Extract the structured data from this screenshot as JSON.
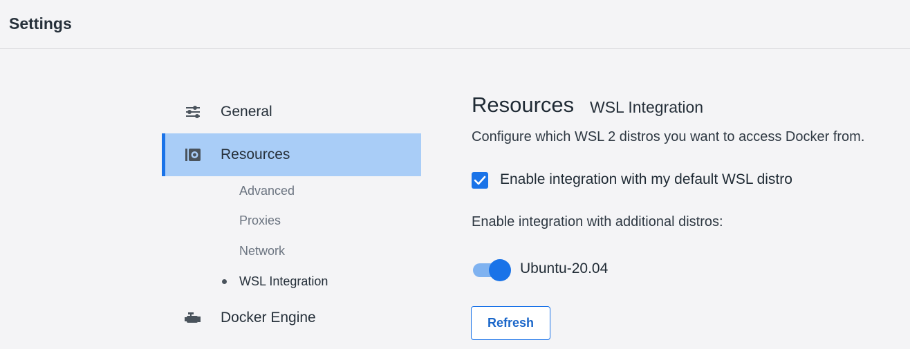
{
  "header": {
    "title": "Settings"
  },
  "sidebar": {
    "items": [
      {
        "label": "General",
        "icon": "sliders-icon"
      },
      {
        "label": "Resources",
        "icon": "resources-icon",
        "active": true
      },
      {
        "label": "Docker Engine",
        "icon": "engine-icon"
      }
    ],
    "subitems": [
      {
        "label": "Advanced"
      },
      {
        "label": "Proxies"
      },
      {
        "label": "Network"
      },
      {
        "label": "WSL Integration",
        "current": true
      }
    ]
  },
  "main": {
    "title": "Resources",
    "subtitle": "WSL Integration",
    "description": "Configure which WSL 2 distros you want to access Docker from.",
    "default_distro": {
      "label": "Enable integration with my default WSL distro",
      "checked": true
    },
    "additional_label": "Enable integration with additional distros:",
    "distros": [
      {
        "name": "Ubuntu-20.04",
        "enabled": true
      }
    ],
    "refresh_label": "Refresh"
  },
  "colors": {
    "accent": "#1a73e8",
    "active_bg": "#a9cdf7",
    "background": "#f4f4f6"
  }
}
